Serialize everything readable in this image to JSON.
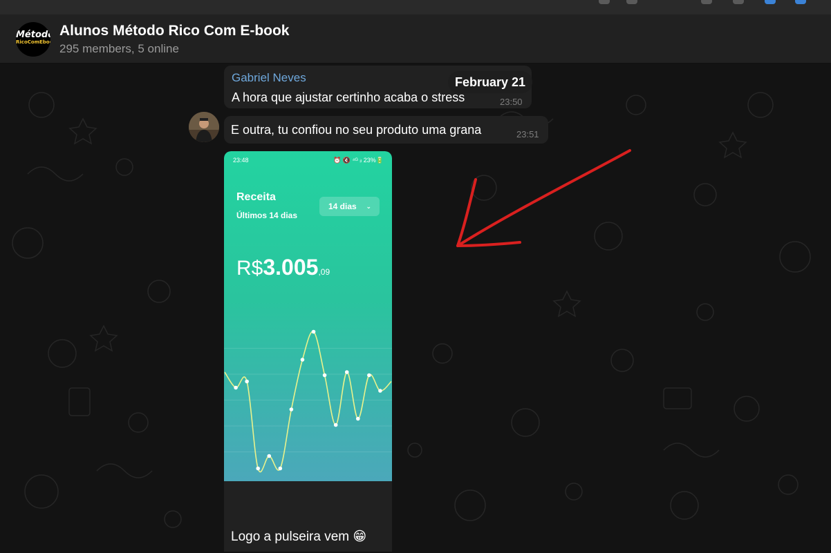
{
  "header": {
    "chat_title": "Alunos Método Rico Com E-book",
    "chat_subtitle": "295 members, 5 online",
    "group_logo": {
      "line1": "Método",
      "line2": "RicoComEbook"
    }
  },
  "date_pill": "February 21",
  "messages": [
    {
      "sender": "Gabriel Neves",
      "text": "A hora que ajustar certinho acaba o stress",
      "time": "23:50"
    },
    {
      "text": "E outra, tu confiou no seu produto uma grana",
      "time": "23:51"
    },
    {
      "caption": "Logo a pulseira vem 😁",
      "screenshot": {
        "status_time": "23:48",
        "status_right": "⏰ 🔇 ⁴ᴳ ᵢₗ 23%🔋",
        "title": "Receita",
        "subtitle": "Últimos 14 dias",
        "period_button": "14 dias",
        "amount_currency": "R$",
        "amount_value": "3.005",
        "amount_cents": ",09",
        "line_color": "#e9f28c",
        "nav_icons": [
          "home-icon",
          "chart-icon",
          "profile-icon"
        ],
        "system_nav": [
          "|||",
          "○",
          "‹"
        ]
      }
    }
  ],
  "chart_data": {
    "type": "line",
    "title": "",
    "xlabel": "",
    "ylabel": "",
    "series": [
      {
        "values": [
          0.34,
          0.29,
          0.31,
          0.03,
          0.07,
          0.03,
          0.22,
          0.38,
          0.47,
          0.33,
          0.17,
          0.34,
          0.19,
          0.33,
          0.28,
          0.31
        ]
      }
    ]
  }
}
